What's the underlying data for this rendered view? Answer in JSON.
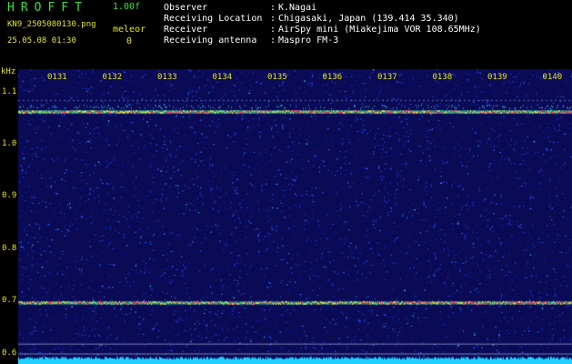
{
  "header": {
    "app_title": "HROFFT",
    "version": "1.00f",
    "filename": "KN9_2505080130.png",
    "datetime": "25.05.08 01:30",
    "meleor_label": "meleor",
    "meleor_count": "0"
  },
  "info": [
    {
      "label": "Observer",
      "sep": ":",
      "value": "K.Nagai"
    },
    {
      "label": "Receiving Location",
      "sep": ":",
      "value": "Chigasaki, Japan (139.414 35.340)"
    },
    {
      "label": "Receiver",
      "sep": ":",
      "value": "AirSpy mini (Miakejima VOR 108.65MHz)"
    },
    {
      "label": "Receiving antenna",
      "sep": ":",
      "value": "Maspro FM-3"
    }
  ],
  "axis": {
    "unit": "kHz",
    "y_ticks": [
      "1.1",
      "1.0",
      "0.9",
      "0.8",
      "0.7",
      "0.6"
    ],
    "x_ticks": [
      "0131",
      "0132",
      "0133",
      "0134",
      "0135",
      "0136",
      "0137",
      "0138",
      "0139",
      "0140"
    ]
  },
  "colors": {
    "background": "#0a0a55",
    "text_green": "#38e038",
    "text_yellow": "#e6e61e",
    "carrier": "#ff3c64",
    "floor": "#20d0ff"
  },
  "chart_data": {
    "type": "heatmap",
    "xlabel": "",
    "ylabel": "kHz",
    "x_categories": [
      "0131",
      "0132",
      "0133",
      "0134",
      "0135",
      "0136",
      "0137",
      "0138",
      "0139",
      "0140"
    ],
    "ylim": [
      0.58,
      1.145
    ],
    "signal_lines_khz": [
      1.063,
      0.697
    ]
  }
}
